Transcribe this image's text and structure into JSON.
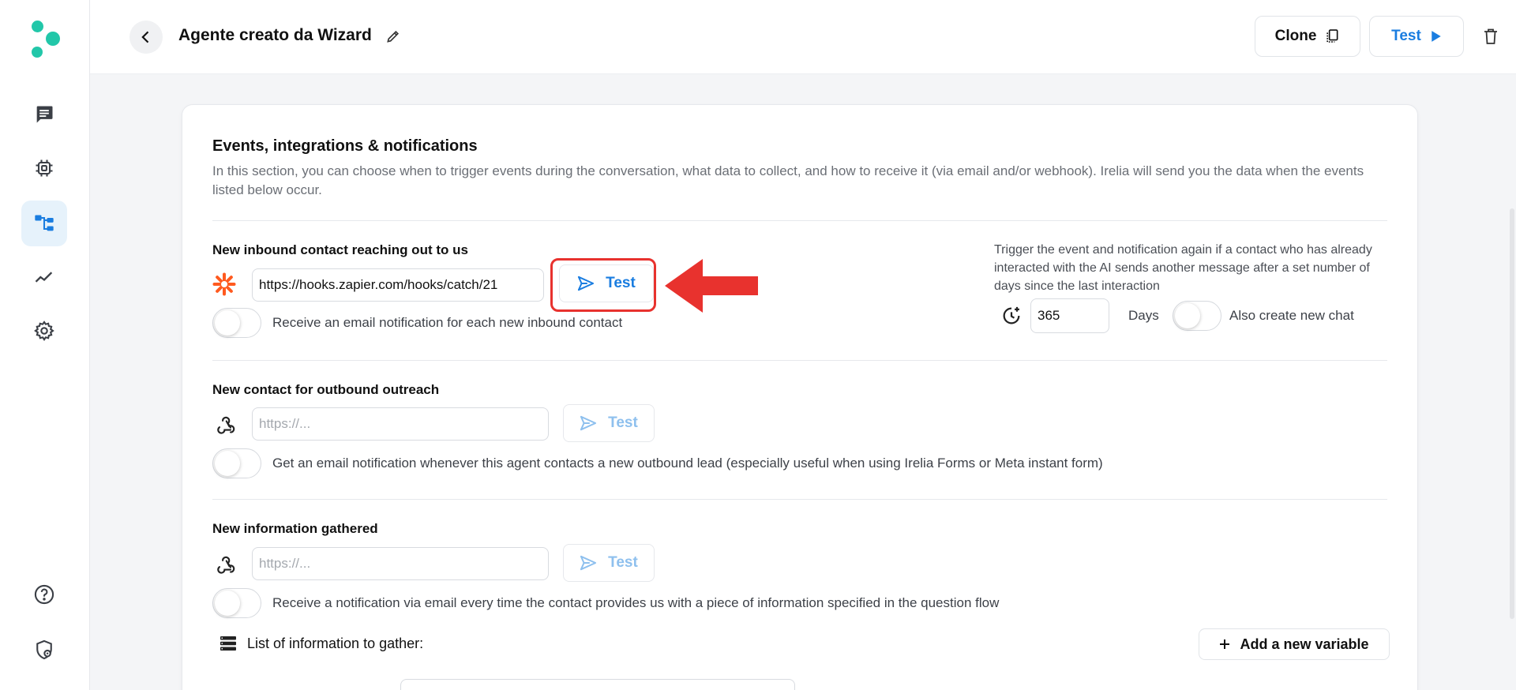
{
  "sidebar": {
    "logo_color": "#22c7a9",
    "items": [
      {
        "icon": "chat-icon",
        "active": false
      },
      {
        "icon": "chip-icon",
        "active": false
      },
      {
        "icon": "flow-icon",
        "active": true
      },
      {
        "icon": "analytics-icon",
        "active": false
      },
      {
        "icon": "settings-icon",
        "active": false
      }
    ],
    "bottom_items": [
      {
        "icon": "help-icon"
      },
      {
        "icon": "privacy-icon"
      }
    ]
  },
  "header": {
    "title": "Agente creato da Wizard",
    "clone_label": "Clone",
    "test_label": "Test",
    "accent_color": "#1a7de0"
  },
  "section": {
    "title": "Events, integrations & notifications",
    "description": "In this section, you can choose when to trigger events during the conversation, what data to collect, and how to receive it (via email and/or webhook). Irelia will send you the data when the events listed below occur."
  },
  "inbound": {
    "title": "New inbound contact reaching out to us",
    "webhook_value": "https://hooks.zapier.com/hooks/catch/21",
    "test_label": "Test",
    "toggle_label": "Receive an email notification for each new inbound contact",
    "toggle_on": false,
    "retrigger_text": "Trigger the event and notification again if a contact who has already interacted with the AI sends another message after a set number of days since the last interaction",
    "days_value": "365",
    "days_label": "Days",
    "new_chat_label": "Also create new chat",
    "new_chat_on": false
  },
  "outbound": {
    "title": "New contact for outbound outreach",
    "webhook_placeholder": "https://...",
    "test_label": "Test",
    "toggle_label": "Get an email notification whenever this agent contacts a new outbound lead (especially useful when using Irelia Forms or Meta instant form)",
    "toggle_on": false
  },
  "info": {
    "title": "New information gathered",
    "webhook_placeholder": "https://...",
    "test_label": "Test",
    "toggle_label": "Receive a notification via email every time the contact provides us with a piece of information specified in the question flow",
    "toggle_on": false,
    "list_label": "List of information to gather:",
    "add_variable_label": "Add a new variable"
  },
  "annotation": {
    "highlight_color": "#e8322e"
  }
}
